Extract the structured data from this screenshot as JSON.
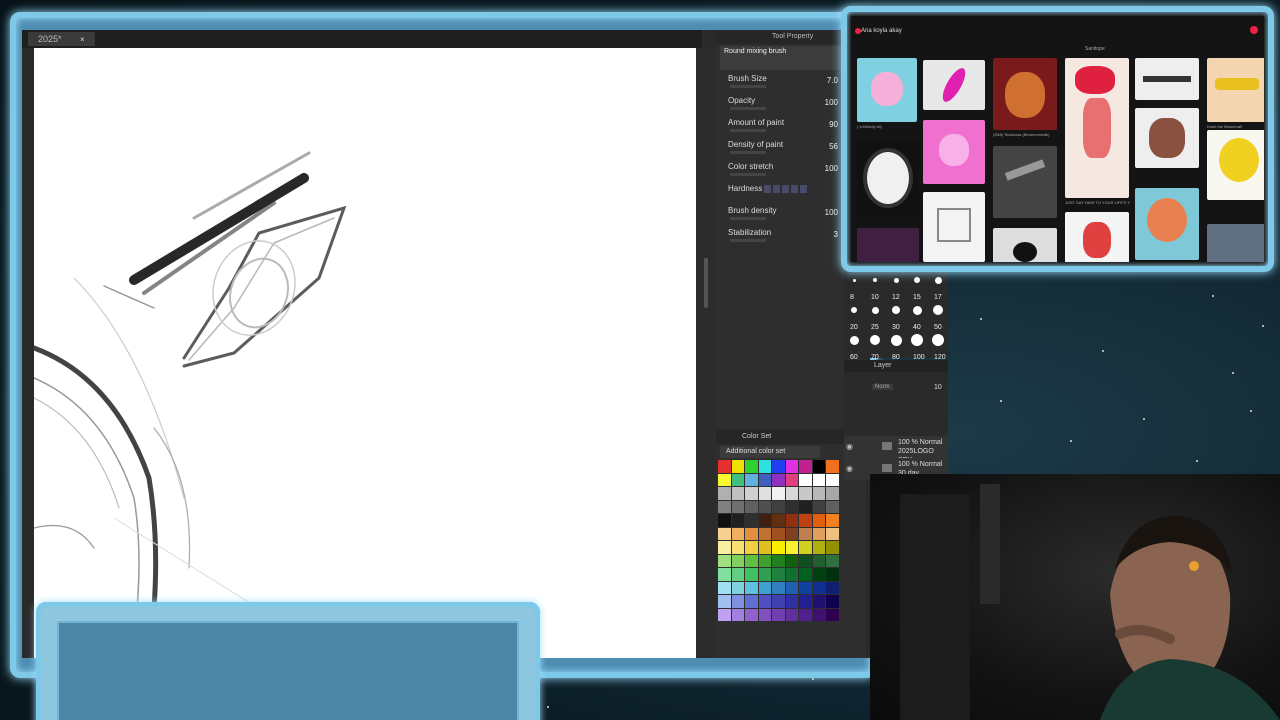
{
  "document": {
    "tab_title": "2025*",
    "tab_close": "×"
  },
  "tool_property": {
    "header": "Tool Property",
    "brush_name": "Round mixing brush",
    "rows": [
      {
        "label": "Brush Size",
        "value": "7.0"
      },
      {
        "label": "Opacity",
        "value": "100"
      },
      {
        "label": "Amount of paint",
        "value": "90"
      },
      {
        "label": "Density of paint",
        "value": "56"
      },
      {
        "label": "Color stretch",
        "value": "100"
      },
      {
        "label": "Hardness",
        "value": ""
      },
      {
        "label": "Brush density",
        "value": "100"
      },
      {
        "label": "Stabilization",
        "value": "3"
      }
    ]
  },
  "color_set": {
    "header": "Color Set",
    "selected": "Additional color set",
    "swatches": [
      "#e53030",
      "#f0e000",
      "#30d030",
      "#30e0e0",
      "#2040f0",
      "#e030e0",
      "#c02090",
      "#000000",
      "#f07020",
      "#f8f830",
      "#40c080",
      "#60b0e0",
      "#4060c0",
      "#9030c0",
      "#e04080",
      "#ffffff",
      "#ffffff",
      "#ffffff",
      "#b0b0b0",
      "#c0c0c0",
      "#d0d0d0",
      "#e0e0e0",
      "#f0f0f0",
      "#d8d8d8",
      "#c8c8c8",
      "#b8b8b8",
      "#a8a8a8",
      "#808080",
      "#707070",
      "#606060",
      "#505050",
      "#404040",
      "#303030",
      "#202020",
      "#404040",
      "#606060",
      "#101010",
      "#202020",
      "#303030",
      "#402010",
      "#603010",
      "#903010",
      "#c04010",
      "#e06010",
      "#f08020",
      "#f8d090",
      "#f0b060",
      "#e09040",
      "#c07030",
      "#a05020",
      "#804020",
      "#c08050",
      "#e0a060",
      "#f0c080",
      "#f8f0a0",
      "#f8e070",
      "#f0d040",
      "#e0c020",
      "#f8f000",
      "#f8f030",
      "#d0d020",
      "#b0b010",
      "#909000",
      "#a0e080",
      "#80d060",
      "#60c040",
      "#40a030",
      "#208020",
      "#106010",
      "#105020",
      "#206030",
      "#307040",
      "#80e0a0",
      "#60d080",
      "#40c060",
      "#30a050",
      "#208040",
      "#107030",
      "#006020",
      "#004010",
      "#003010",
      "#a0e0f0",
      "#80d0e0",
      "#60c0e0",
      "#40a0d0",
      "#3080c0",
      "#2060b0",
      "#1040a0",
      "#103090",
      "#102070",
      "#a0c0f0",
      "#8090e0",
      "#6070d0",
      "#5050c0",
      "#4040b0",
      "#3030a0",
      "#202090",
      "#201070",
      "#100050",
      "#c0a0f0",
      "#a080e0",
      "#9060d0",
      "#8050c0",
      "#7040b0",
      "#6030a0",
      "#502090",
      "#401070",
      "#300050"
    ]
  },
  "brush_sizes": [
    "8",
    "10",
    "12",
    "15",
    "17",
    "20",
    "25",
    "30",
    "40",
    "50",
    "60",
    "70",
    "80",
    "100",
    "120"
  ],
  "layer": {
    "header": "Layer",
    "blend": "Norm",
    "opacity": "10",
    "rows": [
      {
        "line1": "100 % Normal",
        "line2": "2025LOGO SEY"
      },
      {
        "line1": "100 % Normal",
        "line2": "30 day"
      }
    ]
  },
  "browser": {
    "title": "Ana koyla akay",
    "subtitle": "Sanitope",
    "captions": [
      "( s.Melody cit)",
      "(2N8) Teddiursa (Benemonicite)",
      "JUST SAY HAIR TO YOUR LIFE'S Y",
      "Kanh the Blumenalf"
    ]
  }
}
